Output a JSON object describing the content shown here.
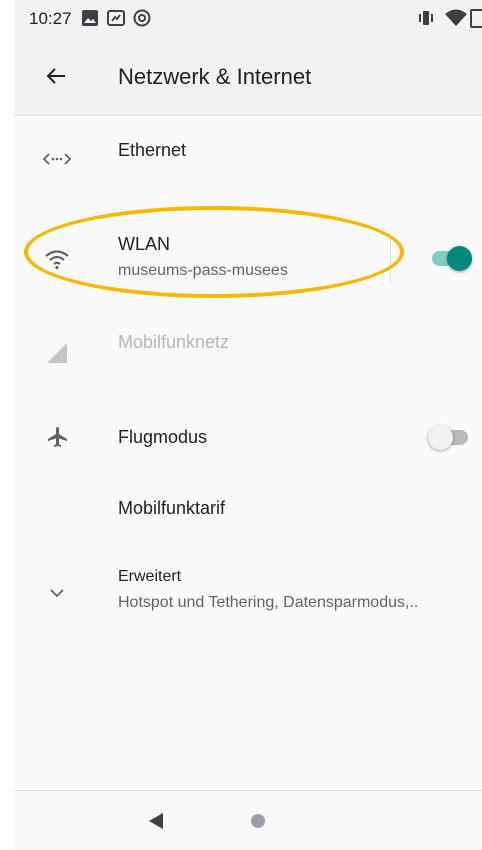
{
  "status_bar": {
    "time": "10:27",
    "icons": [
      "image-icon",
      "screen-icon",
      "at-sign-icon",
      "vibrate-icon",
      "wifi-signal-icon"
    ]
  },
  "app_bar": {
    "title": "Netzwerk & Internet",
    "back_icon": "arrow-back-icon"
  },
  "items": {
    "ethernet": {
      "title": "Ethernet",
      "icon": "ethernet-icon"
    },
    "wlan": {
      "title": "WLAN",
      "subtitle": "museums-pass-musees",
      "icon": "wifi-icon",
      "toggle_on": true
    },
    "mobile": {
      "title": "Mobilfunknetz",
      "icon": "cellular-signal-icon",
      "disabled": true
    },
    "airplane": {
      "title": "Flugmodus",
      "icon": "airplane-icon",
      "toggle_on": false
    },
    "tariff": {
      "title": "Mobilfunktarif"
    },
    "advanced": {
      "title": "Erweitert",
      "subtitle": "Hotspot und Tethering, Datensparmodus,..",
      "icon": "chevron-down-icon"
    }
  },
  "nav_bar": {
    "icons": [
      "back-triangle-icon",
      "home-circle-icon"
    ]
  },
  "colors": {
    "accent": "#00897b",
    "accent_track": "#80cbc4",
    "highlight": "#f7b900",
    "switch_off_thumb": "#f1f1f1",
    "switch_off_track": "#b9b9b9"
  }
}
